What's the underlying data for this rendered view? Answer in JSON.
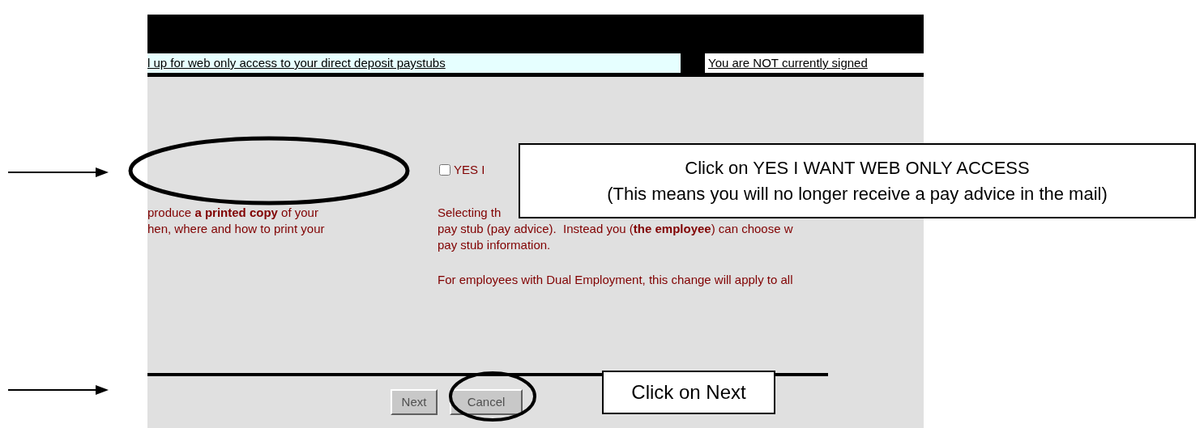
{
  "header": {
    "title": "l up for web only access to your direct deposit paystubs",
    "status": "You are NOT currently signed"
  },
  "option": {
    "label": "YES I",
    "checked": false
  },
  "left_text": [
    "produce **a printed copy** of your",
    "hen, where and how to print your"
  ],
  "right_text": [
    "Selecting th",
    "pay stub (pay advice).  Instead you (**the employee**) can choose w",
    "pay stub information."
  ],
  "note": "For employees with Dual Employment, this change will apply to all",
  "buttons": [
    {
      "label": "Next"
    },
    {
      "label": "Cancel"
    }
  ],
  "callouts": [
    {
      "kind": "wide",
      "lines": [
        "Click on YES I WANT WEB ONLY ACCESS",
        "(This means you will no longer receive a pay advice in the mail)"
      ]
    },
    {
      "kind": "small",
      "lines": [
        "Click on Next"
      ]
    }
  ]
}
